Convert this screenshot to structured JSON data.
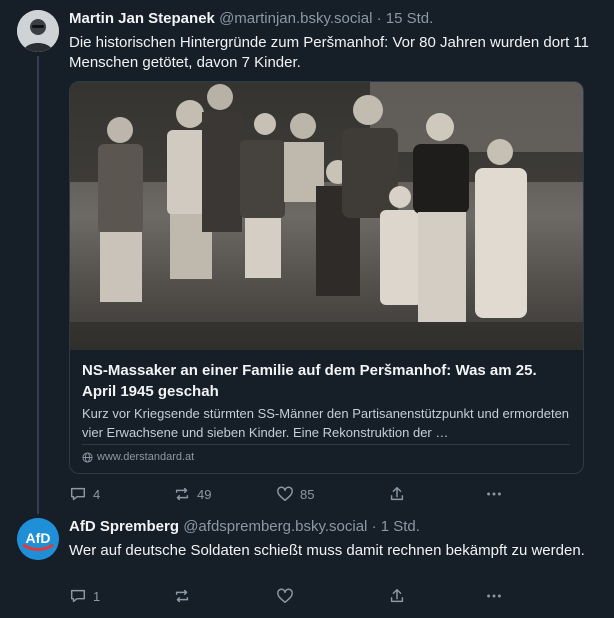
{
  "posts": [
    {
      "author_name": "Martin Jan Stepanek",
      "handle": "@martinjan.bsky.social",
      "time": "· 15 Std.",
      "text": "Die historischen Hintergründe zum Peršmanhof: Vor 80 Jahren wurden dort 11 Menschen getötet, davon 7 Kinder.",
      "avatar_icon": "person-avatar",
      "link_card": {
        "image_icon": "historic-family-photo",
        "title": "NS-Massaker an einer Familie auf dem Peršmanhof: Was am 25. April 1945 geschah",
        "description": "Kurz vor Kriegsende stürmten SS-Männer den Partisanenstützpunkt und ermordeten vier Erwachsene und sieben Kinder. Eine Rekonstruktion der …",
        "domain": "www.derstandard.at"
      },
      "stats": {
        "replies": "4",
        "reposts": "49",
        "likes": "85"
      }
    },
    {
      "author_name": "AfD Spremberg",
      "handle": "@afdspremberg.bsky.social",
      "time": "· 1 Std.",
      "text": "Wer auf deutsche Soldaten schießt muss damit rechnen bekämpft zu werden.",
      "avatar_icon": "afd-logo",
      "avatar_label": "AfD",
      "stats": {
        "replies": "1",
        "reposts": "",
        "likes": ""
      }
    }
  ],
  "icons": {
    "reply": "reply-icon",
    "repost": "repost-icon",
    "like": "heart-icon",
    "share": "share-icon",
    "more": "more-icon"
  },
  "colors": {
    "background": "#161e27",
    "text": "#f1f3f5",
    "muted": "#8b98a5",
    "afd_blue": "#1f8fd8"
  }
}
